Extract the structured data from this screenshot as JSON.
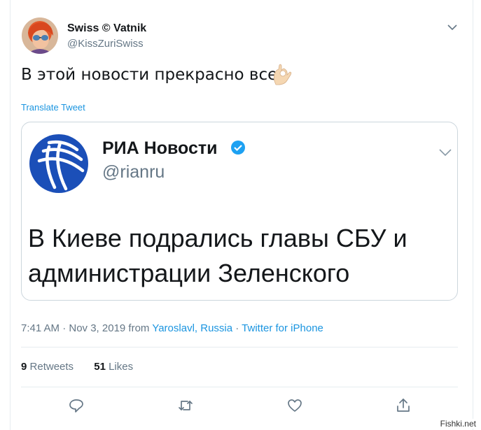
{
  "tweet": {
    "display_name": "Swiss © Vatnik",
    "handle": "@KissZuriSwiss",
    "text": "В этой новости прекрасно все",
    "translate": "Translate Tweet",
    "time": "7:41 AM · Nov 3, 2019 from ",
    "location": "Yaroslavl, Russia",
    "sep": " · ",
    "source": "Twitter for iPhone",
    "retweets_count": "9",
    "retweets_label": "Retweets",
    "likes_count": "51",
    "likes_label": "Likes"
  },
  "quoted": {
    "name": "РИА Новости",
    "handle": "@rianru",
    "text": "В Киеве подрались главы СБУ и администрации Зеленского"
  },
  "icons": [
    "reply-icon",
    "retweet-icon",
    "like-icon",
    "share-icon",
    "chevron-down-icon",
    "verified-icon",
    "ok-hand-icon"
  ],
  "colors": {
    "link": "#1b95e0",
    "secondary": "#657786",
    "verified": "#1da1f2",
    "ria_blue": "#1b4fb8"
  },
  "watermark": "Fishki.net"
}
